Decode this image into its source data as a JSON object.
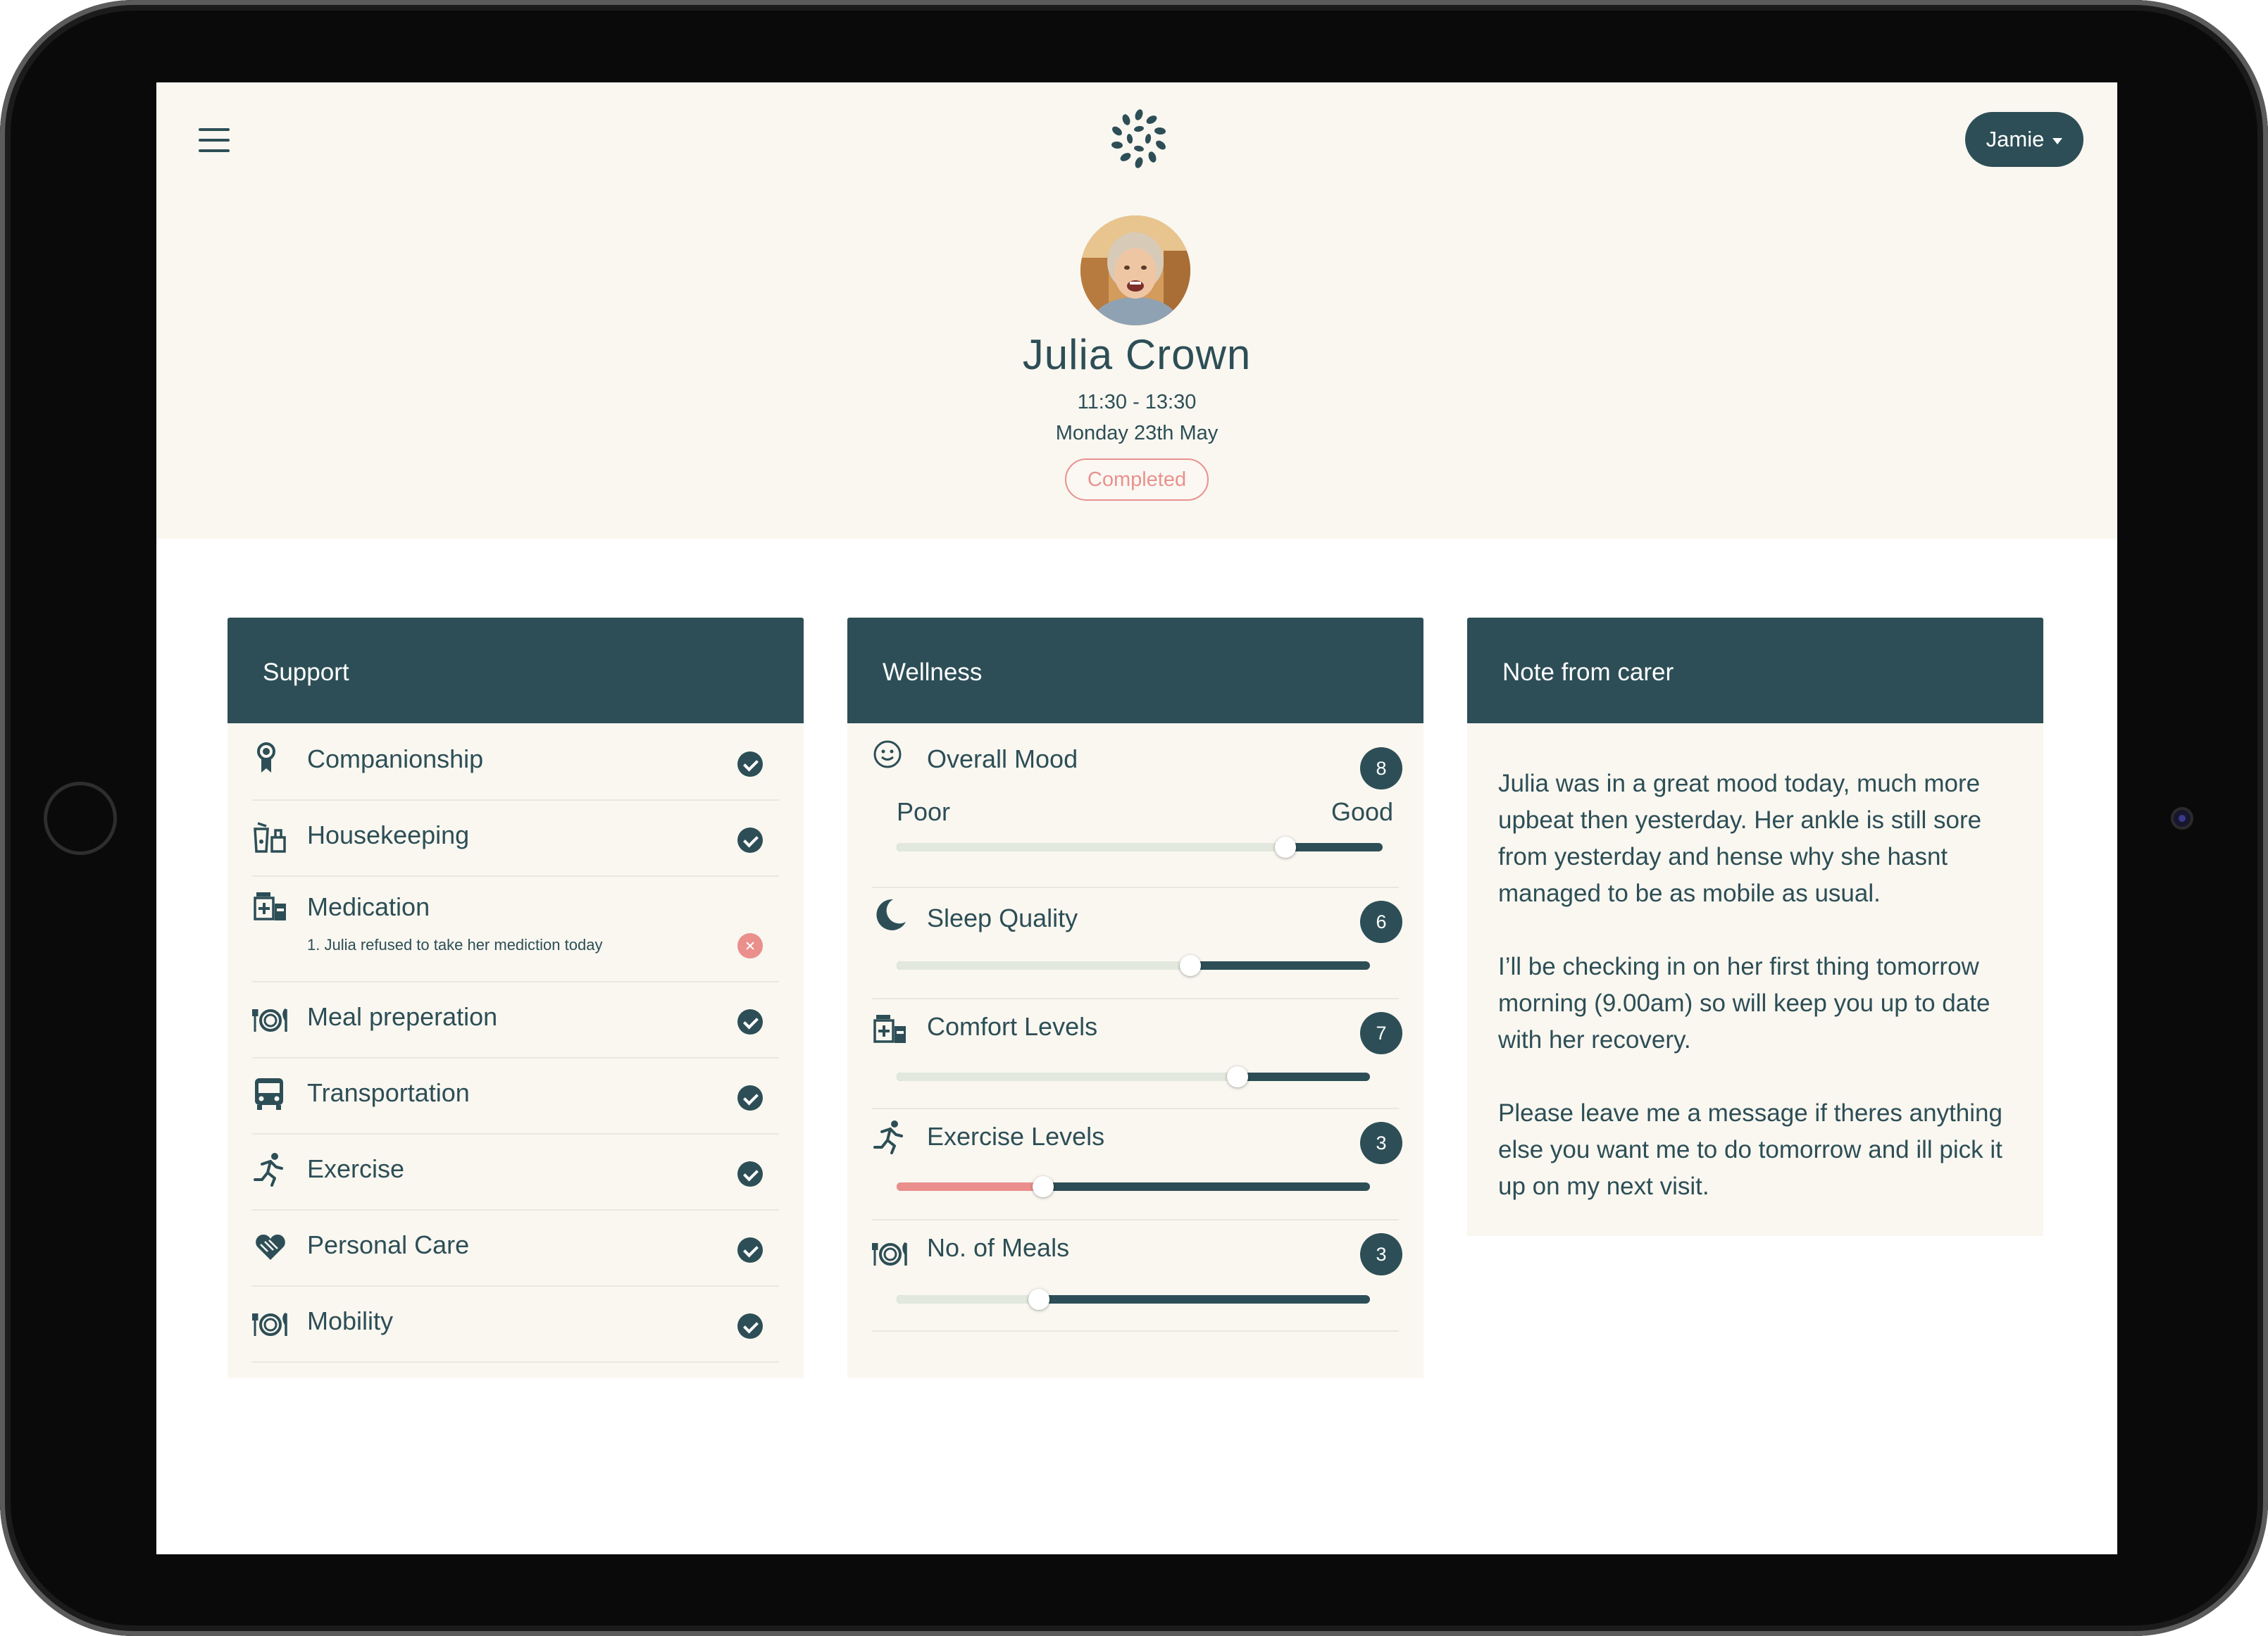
{
  "header": {
    "user_menu_label": "Jamie",
    "status": "Completed"
  },
  "patient": {
    "name": "Julia Crown",
    "time": "11:30 - 13:30",
    "date": "Monday 23th May"
  },
  "support": {
    "title": "Support",
    "items": [
      {
        "label": "Companionship",
        "icon": "award-ribbon-icon",
        "status": "done"
      },
      {
        "label": "Housekeeping",
        "icon": "cleaning-supplies-icon",
        "status": "done"
      },
      {
        "label": "Medication",
        "icon": "medicine-box-icon",
        "status": "refused",
        "note": "1. Julia refused to take her mediction today"
      },
      {
        "label": "Meal preperation",
        "icon": "plate-cutlery-icon",
        "status": "done"
      },
      {
        "label": "Transportation",
        "icon": "bus-icon",
        "status": "done"
      },
      {
        "label": "Exercise",
        "icon": "running-person-icon",
        "status": "done"
      },
      {
        "label": "Personal Care",
        "icon": "caring-hands-heart-icon",
        "status": "done"
      },
      {
        "label": "Mobility",
        "icon": "plate-cutlery-icon",
        "status": "done"
      }
    ]
  },
  "wellness": {
    "title": "Wellness",
    "scale_low": "Poor",
    "scale_high": "Good",
    "items": [
      {
        "label": "Overall Mood",
        "icon": "smiley-face-icon",
        "score": "8",
        "level": 0.8
      },
      {
        "label": "Sleep Quality",
        "icon": "crescent-moon-icon",
        "score": "6",
        "level": 0.62
      },
      {
        "label": "Comfort Levels",
        "icon": "medicine-box-icon",
        "score": "7",
        "level": 0.72
      },
      {
        "label": "Exercise Levels",
        "icon": "running-person-icon",
        "score": "3",
        "level": 0.31
      },
      {
        "label": "No. of Meals",
        "icon": "plate-cutlery-icon",
        "score": "3",
        "level": 0.3
      }
    ]
  },
  "note": {
    "title": "Note from carer",
    "paragraphs": [
      "Julia was in a great mood today, much more upbeat then yesterday. Her ankle is still sore from yesterday and hense why she hasnt managed to be as mobile as usual.",
      "I’ll be checking in on her first thing tomorrow morning (9.00am) so will keep you up to date with her recovery.",
      "Please leave me a message if theres anything else you want me to do tomorrow and ill pick it up on my next visit."
    ]
  },
  "colors": {
    "primary": "#2d4e56",
    "panel": "#f9f7f0",
    "status_red": "#ea8f8c",
    "track_light": "#e2e8dd"
  }
}
